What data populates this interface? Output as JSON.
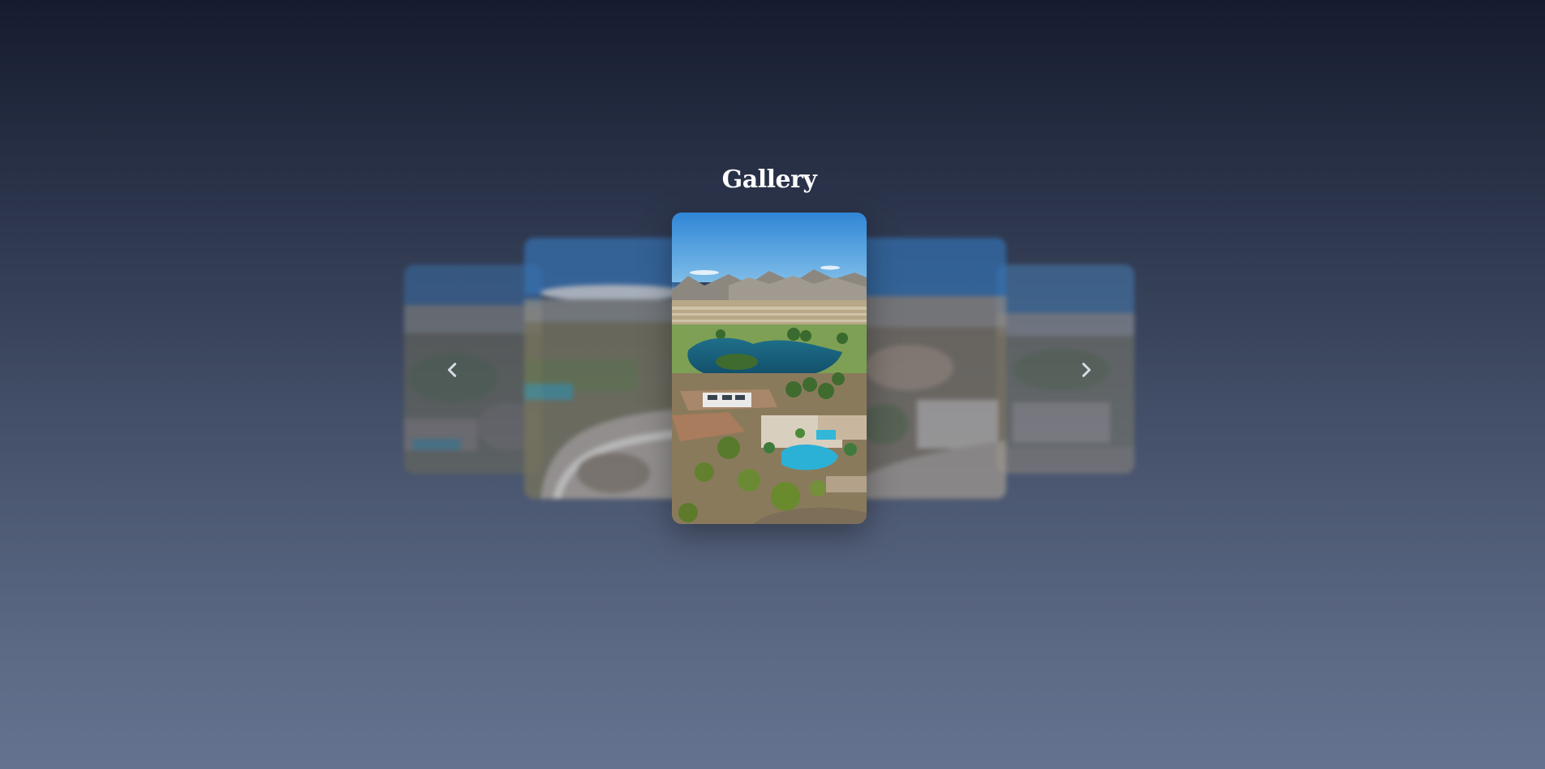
{
  "gallery": {
    "title": "Gallery",
    "slide_count": 5,
    "active_index": 2,
    "slides": [
      {
        "icon": "aerial-photo",
        "description_visible": false
      },
      {
        "icon": "aerial-photo",
        "description_visible": false
      },
      {
        "icon": "aerial-photo",
        "description_visible": false
      },
      {
        "icon": "aerial-photo",
        "description_visible": false
      },
      {
        "icon": "aerial-photo",
        "description_visible": false
      }
    ],
    "controls": {
      "prev_icon": "chevron-left-icon",
      "next_icon": "chevron-right-icon"
    }
  },
  "colors": {
    "background_top": "#161c2f",
    "background_bottom": "#647290",
    "title": "#ffffff",
    "arrow": "#d8dce6"
  }
}
